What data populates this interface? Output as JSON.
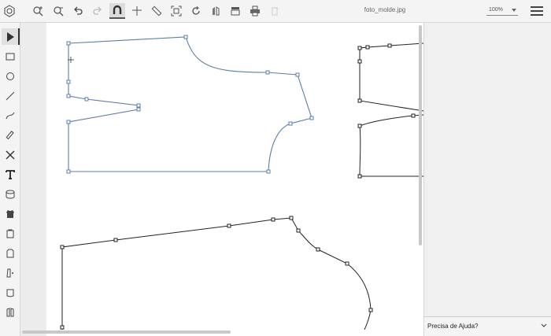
{
  "file": {
    "name": "foto_molde.jpg"
  },
  "zoom": {
    "value": "100%"
  },
  "help": {
    "label": "Precisa de Ajuda?"
  },
  "toolbar": [
    "app-logo-icon",
    "zoom-in-icon",
    "zoom-out-icon",
    "undo-icon",
    "redo-icon",
    "magnet-icon",
    "crosshair-icon",
    "ruler-icon",
    "fit-frame-icon",
    "rotate-icon",
    "mirror-icon",
    "layers-icon",
    "print-icon",
    "delete-icon"
  ],
  "tools": [
    "select-arrow-icon",
    "rectangle-icon",
    "circle-icon",
    "line-icon",
    "curve-icon",
    "pencil-icon",
    "close-x-icon",
    "text-icon",
    "stack-icon",
    "shirt-icon",
    "pattern-front-icon",
    "pattern-back-icon",
    "sleeve-icon",
    "pocket-icon",
    "jacket-icon"
  ]
}
